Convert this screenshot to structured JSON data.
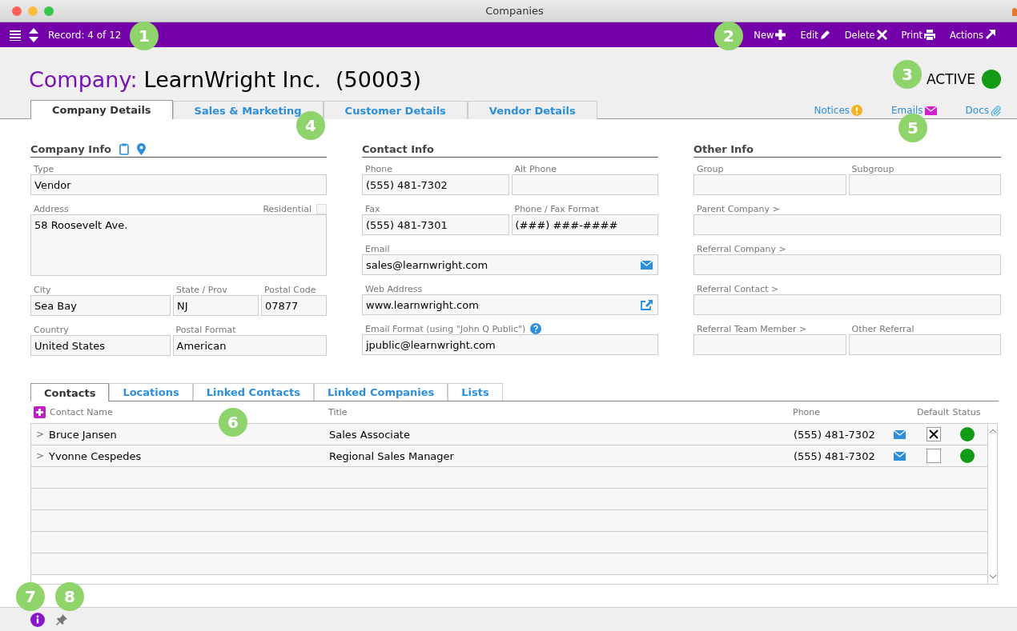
{
  "window": {
    "title": "Companies"
  },
  "toolbar": {
    "record": "Record: 4 of 12",
    "actions": [
      "New",
      "Edit",
      "Delete",
      "Print",
      "Actions"
    ]
  },
  "header": {
    "label": "Company:",
    "name": "LearnWright Inc.",
    "number": "(50003)",
    "status": "ACTIVE"
  },
  "tabs": [
    {
      "label": "Company Details",
      "selected": true
    },
    {
      "label": "Sales & Marketing",
      "selected": false
    },
    {
      "label": "Customer Details",
      "selected": false
    },
    {
      "label": "Vendor Details",
      "selected": false
    }
  ],
  "links": [
    "Notices",
    "Emails",
    "Docs"
  ],
  "sections": [
    {
      "title": "Company Info",
      "rows": [
        [
          {
            "label": "Type",
            "value": "Vendor",
            "kind": "text"
          }
        ],
        [
          {
            "label": "Address",
            "value": "58 Roosevelt Ave.",
            "kind": "textarea",
            "checkbox": {
              "label": "Residential",
              "checked": false
            }
          }
        ],
        [
          {
            "label": "City",
            "value": "Sea Bay",
            "kind": "text"
          },
          {
            "label": "State / Prov",
            "value": "NJ",
            "kind": "text"
          },
          {
            "label": "Postal Code",
            "value": "07877",
            "kind": "text"
          }
        ],
        [
          {
            "label": "Country",
            "value": "United States",
            "kind": "text"
          },
          {
            "label": "Postal Format",
            "value": "American",
            "kind": "text"
          }
        ]
      ]
    },
    {
      "title": "Contact Info",
      "rows": [
        [
          {
            "label": "Phone",
            "value": "(555) 481-7302",
            "kind": "text"
          },
          {
            "label": "Alt Phone",
            "kind": "text"
          }
        ],
        [
          {
            "label": "Fax",
            "value": "(555) 481-7301",
            "kind": "text"
          },
          {
            "label": "Phone / Fax Format",
            "value": "(###) ###-####",
            "kind": "text"
          }
        ],
        [
          {
            "label": "Email",
            "value": "sales@learnwright.com",
            "kind": "email"
          }
        ],
        [
          {
            "label": "Web Address",
            "value": "www.learnwright.com",
            "kind": "url"
          }
        ],
        [
          {
            "label": "Email Format (using \"John Q Public\")",
            "value": "jpublic@learnwright.com",
            "kind": "text",
            "help": true
          }
        ]
      ]
    },
    {
      "title": "Other Info",
      "rows": [
        [
          {
            "label": "Group",
            "kind": "text"
          },
          {
            "label": "Subgroup",
            "kind": "text"
          }
        ],
        [
          {
            "label": "Parent Company >",
            "kind": "text"
          }
        ],
        [
          {
            "label": "Referral Company >",
            "kind": "text"
          }
        ],
        [
          {
            "label": "Referral Contact >",
            "kind": "text"
          }
        ],
        [
          {
            "label": "Referral Team Member >",
            "kind": "text"
          },
          {
            "label": "Other Referral",
            "kind": "text"
          }
        ]
      ]
    }
  ],
  "subtabs": [
    {
      "label": "Contacts",
      "selected": true
    },
    {
      "label": "Locations",
      "selected": false
    },
    {
      "label": "Linked Contacts",
      "selected": false
    },
    {
      "label": "Linked Companies",
      "selected": false
    },
    {
      "label": "Lists",
      "selected": false
    }
  ],
  "table": {
    "columns": [
      "Contact Name",
      "Title",
      "Phone",
      "Default",
      "Status"
    ],
    "rows": [
      {
        "expander": ">",
        "name": "Bruce Jansen",
        "title": "Sales Associate",
        "phone": "(555) 481-7302",
        "default": true,
        "color": "#129b14"
      },
      {
        "expander": ">",
        "name": "Yvonne Cespedes",
        "title": "Regional Sales Manager",
        "phone": "(555) 481-7302",
        "default": false,
        "color": "#129b14"
      }
    ]
  },
  "callouts": [
    "1",
    "2",
    "3",
    "4",
    "5",
    "6",
    "7",
    "8"
  ]
}
